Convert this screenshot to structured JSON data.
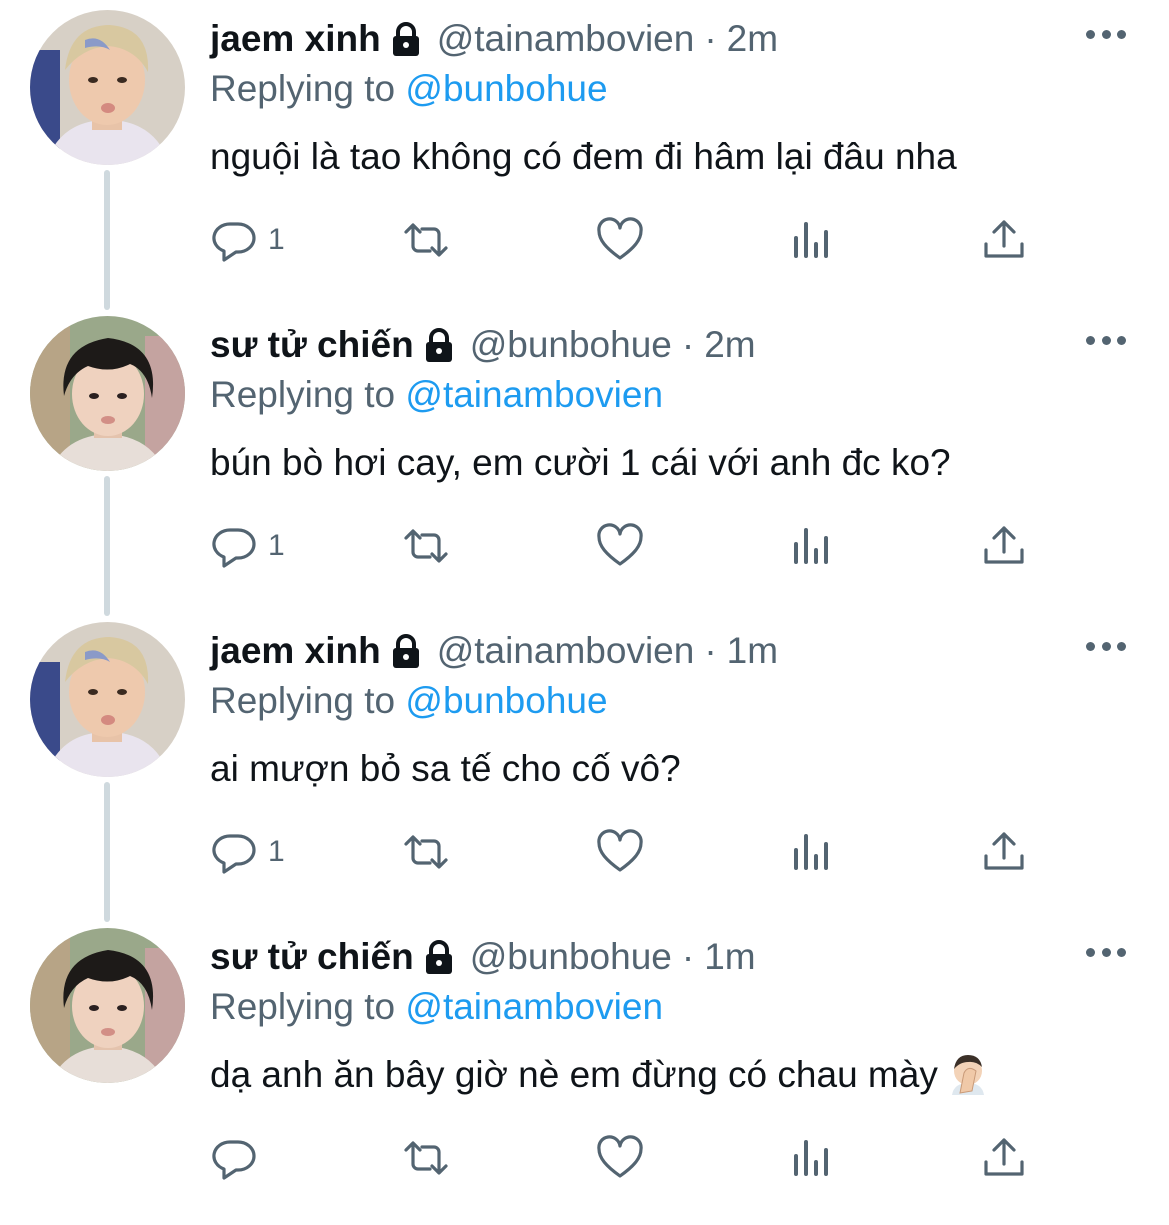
{
  "thread": {
    "tweets": [
      {
        "name": "jaem xinh",
        "handle": "@tainambovien",
        "separator": "·",
        "time": "2m",
        "replying_prefix": "Replying to",
        "replying_to": "@bunbohue",
        "text": "nguội là tao không có đem đi hâm lại đâu nha",
        "reply_count": "1",
        "avatar": "jaem-avatar"
      },
      {
        "name": "sư tử chiến",
        "handle": "@bunbohue",
        "separator": "·",
        "time": "2m",
        "replying_prefix": "Replying to",
        "replying_to": "@tainambovien",
        "text": "bún bò hơi cay, em cười 1 cái với anh đc ko?",
        "reply_count": "1",
        "avatar": "chien-avatar"
      },
      {
        "name": "jaem xinh",
        "handle": "@tainambovien",
        "separator": "·",
        "time": "1m",
        "replying_prefix": "Replying to",
        "replying_to": "@bunbohue",
        "text": "ai mượn bỏ sa tế cho cố vô?",
        "reply_count": "1",
        "avatar": "jaem-avatar"
      },
      {
        "name": "sư tử chiến",
        "handle": "@bunbohue",
        "separator": "·",
        "time": "1m",
        "replying_prefix": "Replying to",
        "replying_to": "@tainambovien",
        "text": "dạ anh ăn bây giờ nè em đừng có chau mày",
        "emoji": "face-palm-emoji",
        "reply_count": "",
        "avatar": "chien-avatar"
      }
    ]
  },
  "colors": {
    "text": "#0f1419",
    "secondary": "#536471",
    "link": "#1d9bf0",
    "thread_line": "#cfd9de"
  },
  "icons": [
    "lock-icon",
    "more-icon",
    "reply-icon",
    "retweet-icon",
    "like-icon",
    "views-icon",
    "share-icon"
  ]
}
